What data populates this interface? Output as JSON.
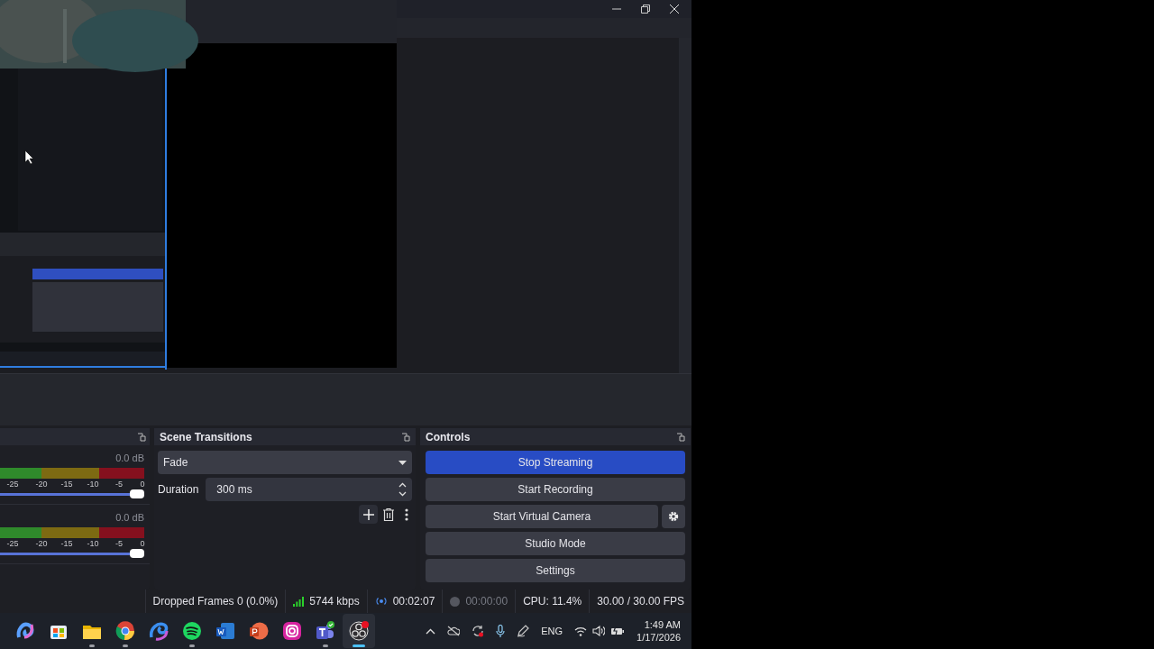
{
  "audio_mixer": {
    "channels": [
      {
        "reading": "0.0 dB",
        "scale": [
          "-25",
          "-20",
          "-15",
          "-10",
          "-5",
          "0"
        ],
        "level": 1
      },
      {
        "reading": "0.0 dB",
        "scale": [
          "-25",
          "-20",
          "-15",
          "-10",
          "-5",
          "0"
        ],
        "level": 1
      }
    ]
  },
  "scene_transitions": {
    "title": "Scene Transitions",
    "transition": "Fade",
    "duration_label": "Duration",
    "duration": "300 ms"
  },
  "controls": {
    "title": "Controls",
    "buttons": [
      {
        "label": "Stop Streaming",
        "active": true,
        "has_settings": false
      },
      {
        "label": "Start Recording",
        "active": false,
        "has_settings": false
      },
      {
        "label": "Start Virtual Camera",
        "active": false,
        "has_settings": true
      },
      {
        "label": "Studio Mode",
        "active": false,
        "has_settings": false
      },
      {
        "label": "Settings",
        "active": false,
        "has_settings": false
      }
    ]
  },
  "status_bar": {
    "dropped_frames": "Dropped Frames 0 (0.0%)",
    "bitrate": "5744 kbps",
    "stream_time": "00:02:07",
    "record_time": "00:00:00",
    "cpu": "CPU: 11.4%",
    "fps": "30.00 / 30.00 FPS"
  },
  "taskbar": {
    "apps": [
      {
        "kind": "swirl",
        "running": false,
        "focused": false
      },
      {
        "kind": "bag",
        "running": false,
        "focused": false
      },
      {
        "kind": "folder",
        "running": true,
        "focused": false
      },
      {
        "kind": "globe",
        "running": true,
        "focused": false
      },
      {
        "kind": "wave",
        "running": false,
        "focused": false
      },
      {
        "kind": "music",
        "running": true,
        "focused": false
      },
      {
        "kind": "doc",
        "running": false,
        "focused": false
      },
      {
        "kind": "slides",
        "running": false,
        "focused": false
      },
      {
        "kind": "camera",
        "running": false,
        "focused": false
      },
      {
        "kind": "people",
        "running": true,
        "focused": false
      },
      {
        "kind": "record",
        "running": true,
        "focused": true
      }
    ],
    "language": "ENG",
    "time": "1:49 AM",
    "date": "1/17/2026"
  }
}
